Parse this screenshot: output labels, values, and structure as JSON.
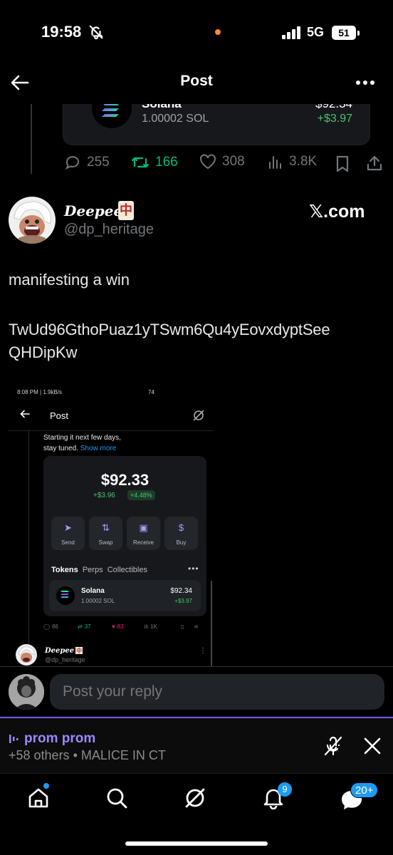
{
  "status": {
    "time": "19:58",
    "network": "5G",
    "battery": "51"
  },
  "header": {
    "title": "Post"
  },
  "previous_post": {
    "token_name": "Solana",
    "token_amount": "1.00002 SOL",
    "token_value": "$92.34",
    "token_change": "+$3.97",
    "replies": "255",
    "reposts": "166",
    "likes": "308",
    "views": "3.8K"
  },
  "post": {
    "author_name": "Deepee",
    "author_emoji": "中",
    "handle": "@dp_heritage",
    "brand": "𝕏.com",
    "text_line1": "manifesting a win",
    "text_line2": "TwUd96GthoPuaz1yTSwm6Qu4yEovxdyptSee",
    "text_line3": "QHDipKw"
  },
  "embedded_screenshot": {
    "status_left": "8:08 PM | 1.9kB/s",
    "status_right": "74",
    "title": "Post",
    "text_line1": "Starting it next few days,",
    "text_line2": "stay tuned.",
    "show_more": "Show more",
    "balance": "$92.33",
    "delta": "+$3.96",
    "pct": "+4.48%",
    "actions": [
      "Send",
      "Swap",
      "Receive",
      "Buy"
    ],
    "tabs": [
      "Tokens",
      "Perps",
      "Collectibles"
    ],
    "token_name": "Solana",
    "token_amount": "1.00002 SOL",
    "token_value": "$92.34",
    "token_change": "+$3.97",
    "replies": "86",
    "reposts": "37",
    "likes": "83",
    "views": "1K",
    "author_name": "Deepee",
    "handle": "@dp_heritage"
  },
  "reply": {
    "placeholder": "Post your reply"
  },
  "space": {
    "title": "prom prom",
    "subtitle": "+58 others • MALICE IN CT"
  },
  "nav": {
    "notifications_badge": "9",
    "messages_badge": "20+"
  },
  "colors": {
    "accent_blue": "#1d9bf0",
    "repost_green": "#00ba7c",
    "like_pink": "#f91880",
    "space_purple": "#7856ff",
    "gain_green": "#46c46a"
  }
}
